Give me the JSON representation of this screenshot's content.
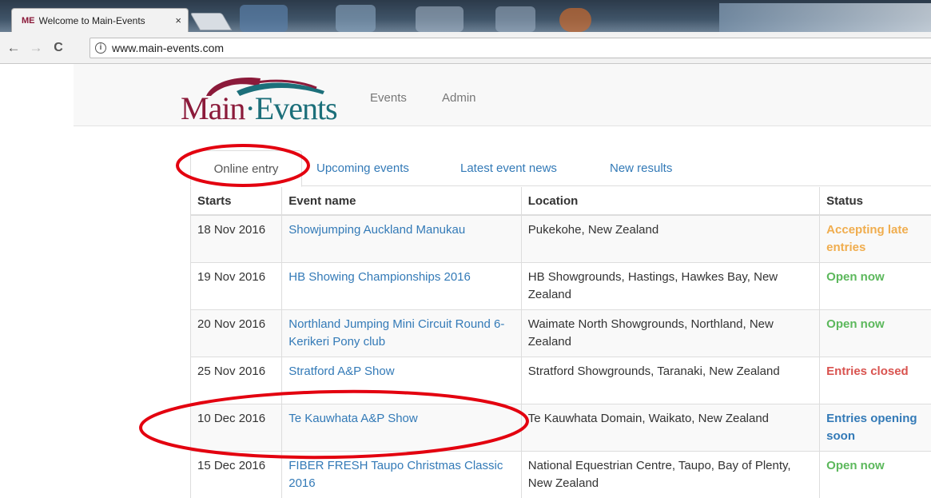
{
  "browser": {
    "tab": {
      "favicon": "ME",
      "title": "Welcome to Main-Events",
      "close": "×"
    },
    "nav": {
      "back": "←",
      "forward": "→",
      "reload": "C"
    },
    "address": {
      "info_icon": "i",
      "url": "www.main-events.com"
    }
  },
  "header": {
    "logo": {
      "part1": "Main",
      "part2": "·Events"
    },
    "nav": [
      "Events",
      "Admin"
    ]
  },
  "tabs": [
    {
      "label": "Online entry",
      "active": true
    },
    {
      "label": "Upcoming events",
      "active": false
    },
    {
      "label": "Latest event news",
      "active": false
    },
    {
      "label": "New results",
      "active": false
    }
  ],
  "table": {
    "headers": [
      "Starts",
      "Event name",
      "Location",
      "Status"
    ],
    "rows": [
      {
        "starts": "18 Nov 2016",
        "event": "Showjumping Auckland Manukau",
        "location": "Pukekohe, New Zealand",
        "status": "Accepting late entries",
        "status_color": "#f0ad4e"
      },
      {
        "starts": "19 Nov 2016",
        "event": "HB Showing Championships 2016",
        "location": "HB Showgrounds, Hastings, Hawkes Bay, New Zealand",
        "status": "Open now",
        "status_color": "#5cb85c"
      },
      {
        "starts": "20 Nov 2016",
        "event": "Northland Jumping Mini Circuit Round 6- Kerikeri Pony club",
        "location": "Waimate North Showgrounds, Northland, New Zealand",
        "status": "Open now",
        "status_color": "#5cb85c"
      },
      {
        "starts": "25 Nov 2016",
        "event": "Stratford A&P Show",
        "location": "Stratford Showgrounds, Taranaki, New Zealand",
        "status": "Entries closed",
        "status_color": "#d9534f"
      },
      {
        "starts": "10 Dec 2016",
        "event": "Te Kauwhata A&P Show",
        "location": "Te Kauwhata Domain, Waikato, New Zealand",
        "status": "Entries opening soon",
        "status_color": "#337ab7"
      },
      {
        "starts": "15 Dec 2016",
        "event": "FIBER FRESH Taupo Christmas Classic 2016",
        "location": "National Equestrian Centre, Taupo, Bay of Plenty, New Zealand",
        "status": "Open now",
        "status_color": "#5cb85c"
      }
    ]
  },
  "colors": {
    "brand_red": "#8b1a3a",
    "brand_teal": "#1c6f7a",
    "link": "#337ab7",
    "annotation": "#e3000f"
  }
}
